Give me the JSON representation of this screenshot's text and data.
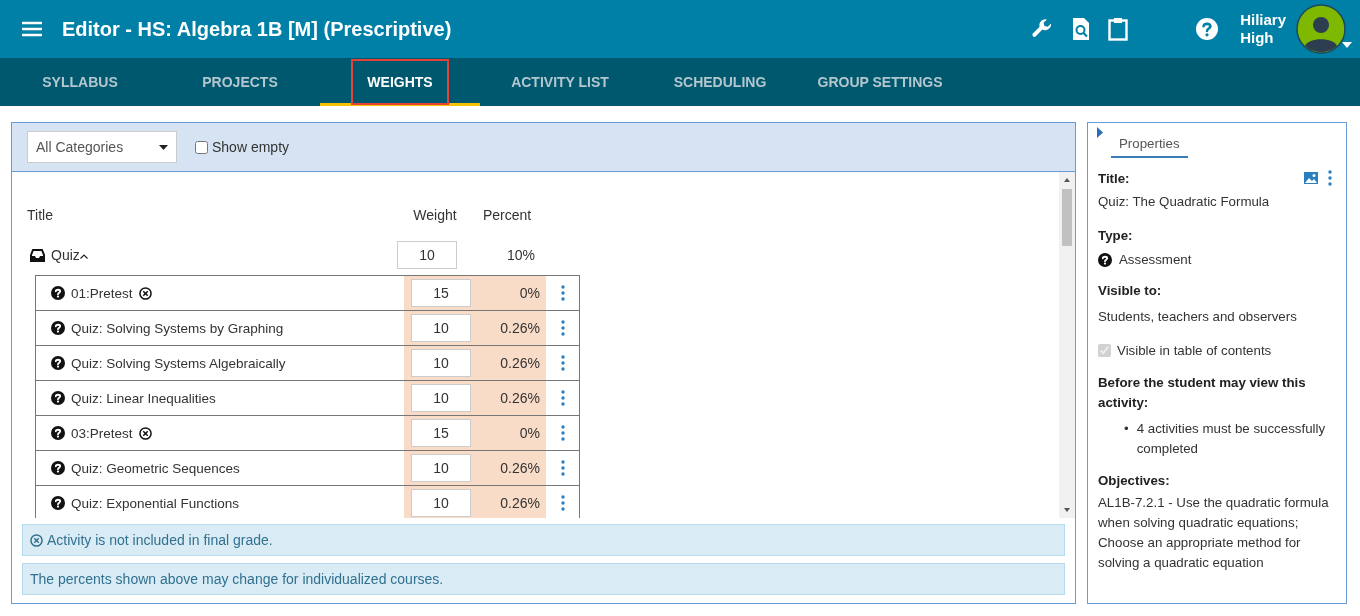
{
  "header": {
    "title": "Editor - HS: Algebra 1B [M] (Prescriptive)",
    "user_name": "Hiliary High"
  },
  "tabs": [
    {
      "label": "SYLLABUS",
      "selected": false,
      "highlighted": false
    },
    {
      "label": "PROJECTS",
      "selected": false,
      "highlighted": false
    },
    {
      "label": "WEIGHTS",
      "selected": true,
      "highlighted": true
    },
    {
      "label": "ACTIVITY LIST",
      "selected": false,
      "highlighted": false
    },
    {
      "label": "SCHEDULING",
      "selected": false,
      "highlighted": false
    },
    {
      "label": "GROUP SETTINGS",
      "selected": false,
      "highlighted": false
    }
  ],
  "toolbar": {
    "category_select": "All Categories",
    "show_empty": {
      "label": "Show empty",
      "checked": false
    }
  },
  "table": {
    "columns": [
      "Title",
      "Weight",
      "Percent"
    ],
    "category": {
      "title": "Quiz",
      "weight": "10",
      "percent": "10%",
      "expanded": true
    },
    "rows": [
      {
        "title": "01:Pretest",
        "weight": "15",
        "percent": "0%",
        "excluded": true
      },
      {
        "title": "Quiz: Solving Systems by Graphing",
        "weight": "10",
        "percent": "0.26%",
        "excluded": false
      },
      {
        "title": "Quiz: Solving Systems Algebraically",
        "weight": "10",
        "percent": "0.26%",
        "excluded": false
      },
      {
        "title": "Quiz: Linear Inequalities",
        "weight": "10",
        "percent": "0.26%",
        "excluded": false
      },
      {
        "title": "03:Pretest",
        "weight": "15",
        "percent": "0%",
        "excluded": true
      },
      {
        "title": "Quiz: Geometric Sequences",
        "weight": "10",
        "percent": "0.26%",
        "excluded": false
      },
      {
        "title": "Quiz: Exponential Functions",
        "weight": "10",
        "percent": "0.26%",
        "excluded": false
      }
    ]
  },
  "notes": [
    {
      "kind": "excluded",
      "text": "Activity is not included in final grade."
    },
    {
      "kind": "plain",
      "text": "The percents shown above may change for individualized courses."
    }
  ],
  "properties": {
    "tab": "Properties",
    "title_label": "Title:",
    "title": "Quiz: The Quadratic Formula",
    "type_label": "Type:",
    "type": "Assessment",
    "visible_label": "Visible to:",
    "visible": "Students, teachers and observers",
    "toc": {
      "label": "Visible in table of contents",
      "checked": true,
      "disabled": true
    },
    "prereq_label": "Before the student may view this activity:",
    "prereqs": [
      {
        "marker": "•",
        "text": "4 activities must be successfully completed"
      }
    ],
    "objectives_label": "Objectives:",
    "objectives": "AL1B-7.2.1 - Use the quadratic formula when solving quadratic equations; Choose an appropriate method for solving a quadratic equation"
  }
}
